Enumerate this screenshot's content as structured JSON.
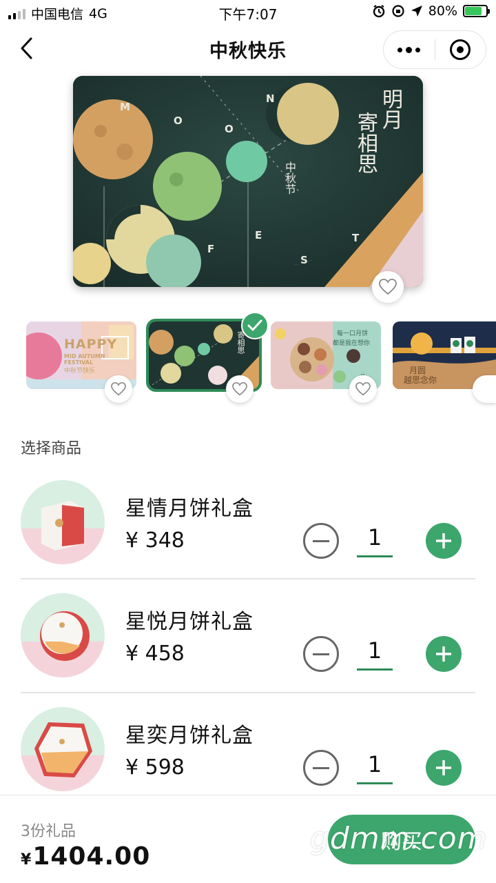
{
  "status_bar": {
    "carrier": "中国电信",
    "network": "4G",
    "time": "下午7:07",
    "battery": "80%",
    "battery_level": 0.8
  },
  "nav": {
    "title": "中秋快乐",
    "icons": [
      "back-icon",
      "more-icon",
      "close-target-icon"
    ]
  },
  "hero_card": {
    "vertical_text_1": "明月",
    "vertical_text_2": "寄相思",
    "festival_text": "中秋节",
    "letters_moon": [
      "M",
      "O",
      "O",
      "N"
    ],
    "letters_fest": [
      "F",
      "E",
      "S",
      "T"
    ],
    "colors": {
      "bg": "#1f3532",
      "gold": "#d9a35f",
      "pink": "#e8cfd4"
    }
  },
  "thumbnails": [
    {
      "title": "HAPPY",
      "sub1": "MID AUTUMN",
      "sub2": "FESTIVAL",
      "sub3": "中秋节快乐",
      "selected": false
    },
    {
      "title": "寄相思",
      "selected": true
    },
    {
      "title": "每一口月饼",
      "sub1": "都是我在想你",
      "badge": "月饼",
      "selected": false
    },
    {
      "title": "月圆",
      "sub1": "越思念你",
      "selected": false
    }
  ],
  "section_title": "选择商品",
  "products": [
    {
      "name": "星情月饼礼盒",
      "price": "¥ 348",
      "qty": "1"
    },
    {
      "name": "星悦月饼礼盒",
      "price": "¥ 458",
      "qty": "1"
    },
    {
      "name": "星奕月饼礼盒",
      "price": "¥ 598",
      "qty": "1"
    }
  ],
  "bottom": {
    "gift_count": "3份礼品",
    "currency": "¥",
    "total": "1404.00",
    "buy_label": "购买"
  },
  "watermark": "gdmm.com",
  "accent_color": "#3ca66c"
}
